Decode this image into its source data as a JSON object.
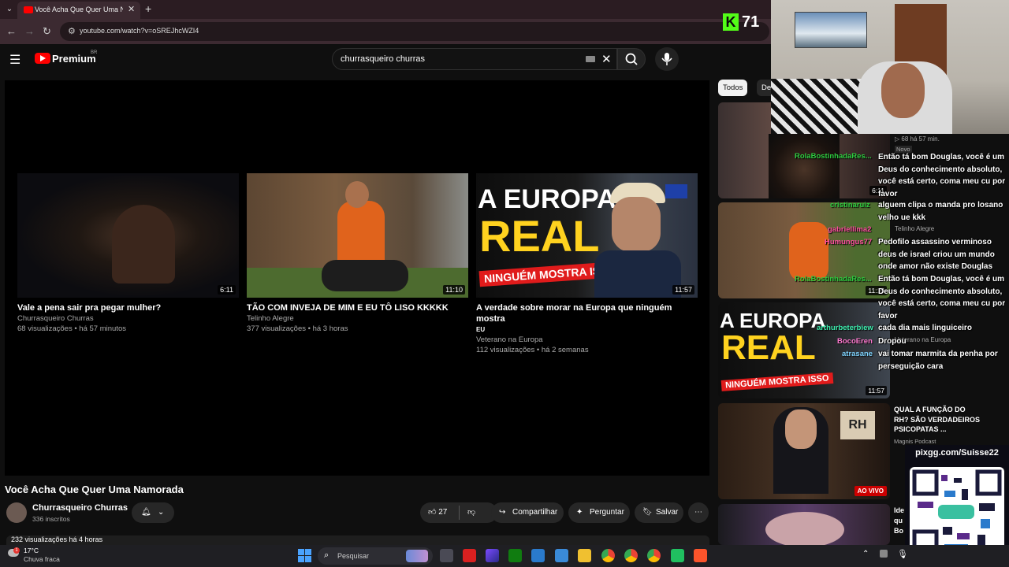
{
  "browser": {
    "tab_title": "Você Acha Que Quer Uma Namorada",
    "tab_close": "✕",
    "new_tab": "+",
    "url": "youtube.com/watch?v=oSREJhcWZI4"
  },
  "youtube": {
    "brand": "Premium",
    "country": "BR",
    "search_query": "churrasqueiro churras"
  },
  "endcards": [
    {
      "title": "Vale a pena sair pra pegar mulher?",
      "channel": "Churrasqueiro Churras",
      "stats": "68 visualizações • há 57 minutos",
      "duration": "6:11",
      "extra": ""
    },
    {
      "title": "TÃO COM INVEJA DE MIM E EU TÔ LISO KKKKK",
      "channel": "Telinho Alegre",
      "stats": "377 visualizações • há 3 horas",
      "duration": "11:10",
      "extra": ""
    },
    {
      "title": "A verdade sobre morar na Europa que ninguém mostra",
      "extra": "EU",
      "channel": "Veterano na Europa",
      "stats": "112 visualizações • há 2 semanas",
      "duration": "11:57",
      "thumb_line1": "A EUROPA",
      "thumb_line2": "REAL",
      "thumb_banner": "NINGUÉM MOSTRA ISSO"
    }
  ],
  "video": {
    "title": "Você Acha Que Quer Uma Namorada",
    "channel": "Churrasqueiro Churras",
    "subscribers": "336 inscritos",
    "likes": "27",
    "share": "Compartilhar",
    "ask": "Perguntar",
    "save": "Salvar",
    "views_line": "232 visualizações  há 4 horas"
  },
  "sidebar": {
    "chips": [
      "Todos",
      "De"
    ],
    "items": [
      {
        "duration": "6:11",
        "meta": "▷ 68  há 57 min.",
        "badge": "Novo"
      },
      {
        "duration": "11:10",
        "meta": "Telinho Alegre"
      },
      {
        "duration": "11:57",
        "meta": "Veterano na Europa",
        "thumb_line1": "A EUROPA",
        "thumb_line2": "REAL",
        "thumb_banner": "NINGUÉM MOSTRA ISSO"
      },
      {
        "title": "QUAL A FUNÇÃO DO RH? SÃO VERDADEIROS PSICOPATAS ...",
        "channel": "Magnis Podcast",
        "live": "AO VIVO",
        "thumb_text": "RH"
      },
      {
        "title": "Ide qu Bo"
      }
    ]
  },
  "overlay": {
    "kick_logo": "K",
    "viewer_count": "71",
    "pix": "pixgg.com/Suisse22",
    "chat_users": [
      {
        "name": "RolaBostinhadaRes...",
        "color": "#2ecc40"
      },
      {
        "name": "cristinaruiz",
        "color": "#2ecc40"
      },
      {
        "name": "gabriellima2",
        "color": "#ff4fa0"
      },
      {
        "name": "Humungus77",
        "color": "#ff4fa0"
      },
      {
        "name": "RolaBostinhadaRes...",
        "color": "#2ecc40"
      },
      {
        "name": "arthurbeterbiew",
        "color": "#3ef0b0"
      },
      {
        "name": "BocoEren",
        "color": "#ff7ad0"
      },
      {
        "name": "atrasane",
        "color": "#7fd4ff"
      }
    ],
    "chat_messages": [
      "Então tá bom Douglas, você é um Deus do conhecimento absoluto, você está certo, coma meu cu por favor",
      "alguem clipa o manda pro losano velho ue kkk",
      "Pedofilo assassino verminoso deus de israel criou um mundo onde amor não existe Douglas",
      "Então tá bom Douglas, você é um Deus do conhecimento absoluto, você está certo, coma meu cu por favor",
      "cada dia mais linguiceiro",
      "Dropou",
      "vai tomar marmita da penha por perseguição cara"
    ]
  },
  "taskbar": {
    "temperature": "17°C",
    "condition": "Chuva fraca",
    "alert_count": "1",
    "search_placeholder": "Pesquisar"
  },
  "colors": {
    "youtube_red": "#ff0000",
    "kick_green": "#53fc18",
    "tab_bg": "#3c2a31",
    "live_red": "#cc0000"
  }
}
